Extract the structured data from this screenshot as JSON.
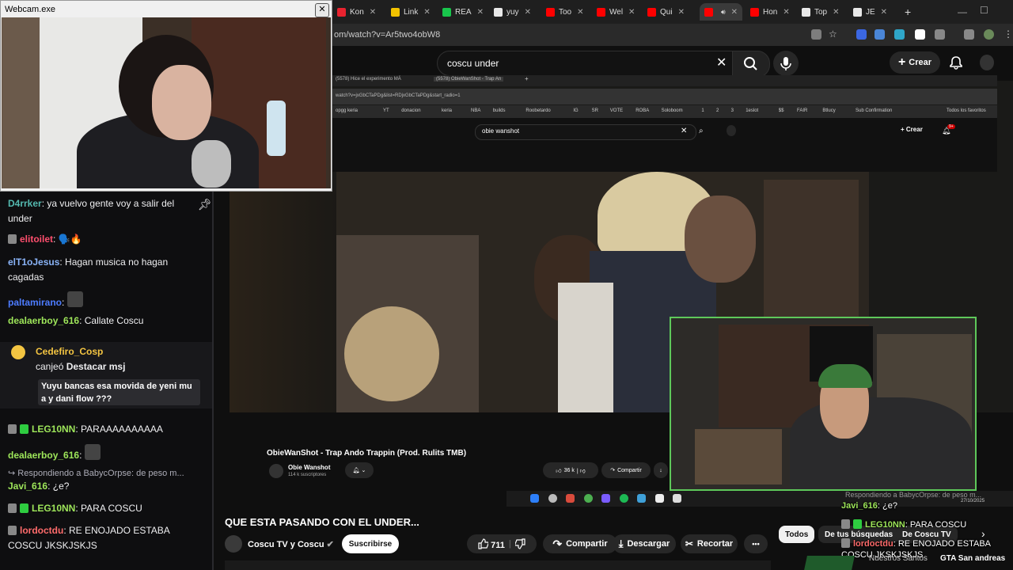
{
  "webcam_window": {
    "title": "Webcam.exe",
    "close_label": "✕"
  },
  "browser": {
    "tabs": [
      {
        "label": "Kon",
        "favicon_color": "#e8232f"
      },
      {
        "label": "Link",
        "favicon_color": "#f2c200"
      },
      {
        "label": "REA",
        "favicon_color": "#18c64c"
      },
      {
        "label": "yuy",
        "favicon_color": "#e8e8e8"
      },
      {
        "label": "Too",
        "favicon_color": "#ff0000"
      },
      {
        "label": "Wel",
        "favicon_color": "#ff0000"
      },
      {
        "label": "Qui",
        "favicon_color": "#ff0000"
      },
      {
        "label": "",
        "favicon_color": "#ff0000"
      },
      {
        "label": "Hon",
        "favicon_color": "#ff0000"
      },
      {
        "label": "Top",
        "favicon_color": "#e8e8e8"
      },
      {
        "label": "JE",
        "favicon_color": "#e8e8e8"
      }
    ],
    "new_tab": "+",
    "url": "om/watch?v=Ar5two4obW8"
  },
  "youtube": {
    "search_value": "coscu under",
    "create_label": "Crear",
    "video_title": "QUE ESTA PASANDO CON EL UNDER...",
    "channel_name": "Coscu TV y Coscu",
    "subscribe_label": "Suscribirse",
    "likes": "711",
    "share_label": "Compartir",
    "download_label": "Descargar",
    "clip_label": "Recortar",
    "more_label": "•••",
    "chips": [
      "Todos",
      "De tus búsquedas",
      "De Coscu TV"
    ]
  },
  "inner_browser": {
    "tabs": [
      "(5578) Hice el experimento MÁ",
      "(5578) ObieWanShot - Trap An"
    ],
    "url": "watch?v=jxGbCTaPDg&list=RDjxGbCTaPDg&start_radio=1",
    "bookmarks": [
      "opgg keria",
      "YT",
      "donacion",
      "keria",
      "NBA",
      "builds",
      "Roobetardo",
      "IG",
      "SR",
      "VOTE",
      "ROBA",
      "Soloboom",
      "1",
      "2",
      "3",
      "1eslot",
      "$$",
      "FAIR",
      "Btlucy",
      "Sub Confirmation",
      "Todos los favoritos"
    ],
    "search_value": "obie wanshot",
    "create_label": "Crear",
    "notif_count": "9+",
    "video_title": "ObieWanShot - Trap Ando Trappin (Prod. Rulits TMB)",
    "channel_name": "Obie Wanshot",
    "subscribers": "114 k suscriptores",
    "likes": "36 k",
    "share_label": "Compartir",
    "taskbar_date": "27/10/2025",
    "overlay_reply": "Respondiendo a BabycOrpse: de peso m..."
  },
  "chat": {
    "messages": [
      {
        "user": "D4rrker",
        "user_color": "#54b9b0",
        "text": "ya vuelvo gente voy a salir del under"
      },
      {
        "user": "elitoilet",
        "user_color": "#ff4f6e",
        "text": "🗣️🔥"
      },
      {
        "user": "elT1oJesus",
        "user_color": "#8ab4f8",
        "text": "Hagan musica no hagan cagadas"
      },
      {
        "user": "paltamirano",
        "user_color": "#4d7cff",
        "text": ""
      },
      {
        "user": "dealaerboy_616",
        "user_color": "#9ee65a",
        "text": "Callate Coscu"
      },
      {
        "user": "LEG10NN",
        "user_color": "#9ee65a",
        "text": "PARAAAAAAAAAA"
      },
      {
        "user": "dealaerboy_616",
        "user_color": "#9ee65a",
        "text": ""
      },
      {
        "user": "Javi_616",
        "user_color": "#9ee65a",
        "text": "¿e?"
      },
      {
        "user": "LEG10NN",
        "user_color": "#9ee65a",
        "text": "PARA COSCU"
      },
      {
        "user": "lordoctdu",
        "user_color": "#ff6b6b",
        "text": "RE ENOJADO ESTABA COSCU JKSKJSKJS"
      }
    ],
    "reply_context": "Respondiendo a BabycOrpse: de peso m...",
    "redeem": {
      "user": "Cedefiro_Cosp",
      "action": "canjeó",
      "reward": "Destacar msj",
      "message": "Yuyu bancas esa movida de yeni mu a y dani flow ???"
    },
    "pin_icon": "pin-icon"
  },
  "overlay_chat": [
    {
      "user": "Javi_616",
      "text": "¿e?"
    },
    {
      "user": "LEG10NN",
      "text": "PARA COSCU"
    },
    {
      "user": "lordoctdu",
      "text": "RE ENOJADO ESTABA COSCU JKSKJSKJS"
    }
  ],
  "overlay_extra": {
    "suggest_channel": "Nuestros Santos",
    "suggest_title": "GTA San andreas"
  },
  "colors": {
    "accent_green": "#5ec85a",
    "youtube_red": "#ff0000"
  }
}
